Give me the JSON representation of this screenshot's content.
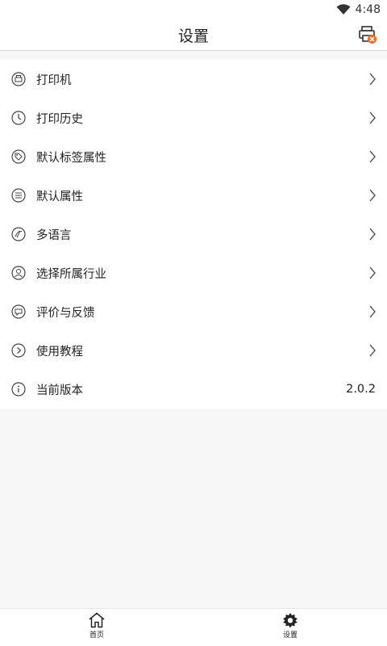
{
  "status_bar": {
    "time": "4:48",
    "icons": [
      "wifi-icon"
    ]
  },
  "header": {
    "title": "设置",
    "right_icon": "printer-error-icon"
  },
  "menu": [
    {
      "label": "打印机",
      "icon": "printer-circle-icon",
      "chevron": true
    },
    {
      "label": "打印历史",
      "icon": "clock-icon",
      "chevron": true
    },
    {
      "label": "默认标签属性",
      "icon": "tag-icon",
      "chevron": true
    },
    {
      "label": "默认属性",
      "icon": "list-icon",
      "chevron": true
    },
    {
      "label": "多语言",
      "icon": "language-icon",
      "chevron": true
    },
    {
      "label": "选择所属行业",
      "icon": "industry-icon",
      "chevron": true
    },
    {
      "label": "评价与反馈",
      "icon": "feedback-icon",
      "chevron": true
    },
    {
      "label": "使用教程",
      "icon": "play-icon",
      "chevron": true
    },
    {
      "label": "当前版本",
      "icon": "info-icon",
      "value": "2.0.2"
    }
  ],
  "tabbar": {
    "tabs": [
      {
        "label": "首页",
        "icon": "home-icon"
      },
      {
        "label": "设置",
        "icon": "gear-icon"
      }
    ]
  },
  "colors": {
    "accent": "#f26a21",
    "background": "#f7f7f7",
    "text": "#222222"
  }
}
